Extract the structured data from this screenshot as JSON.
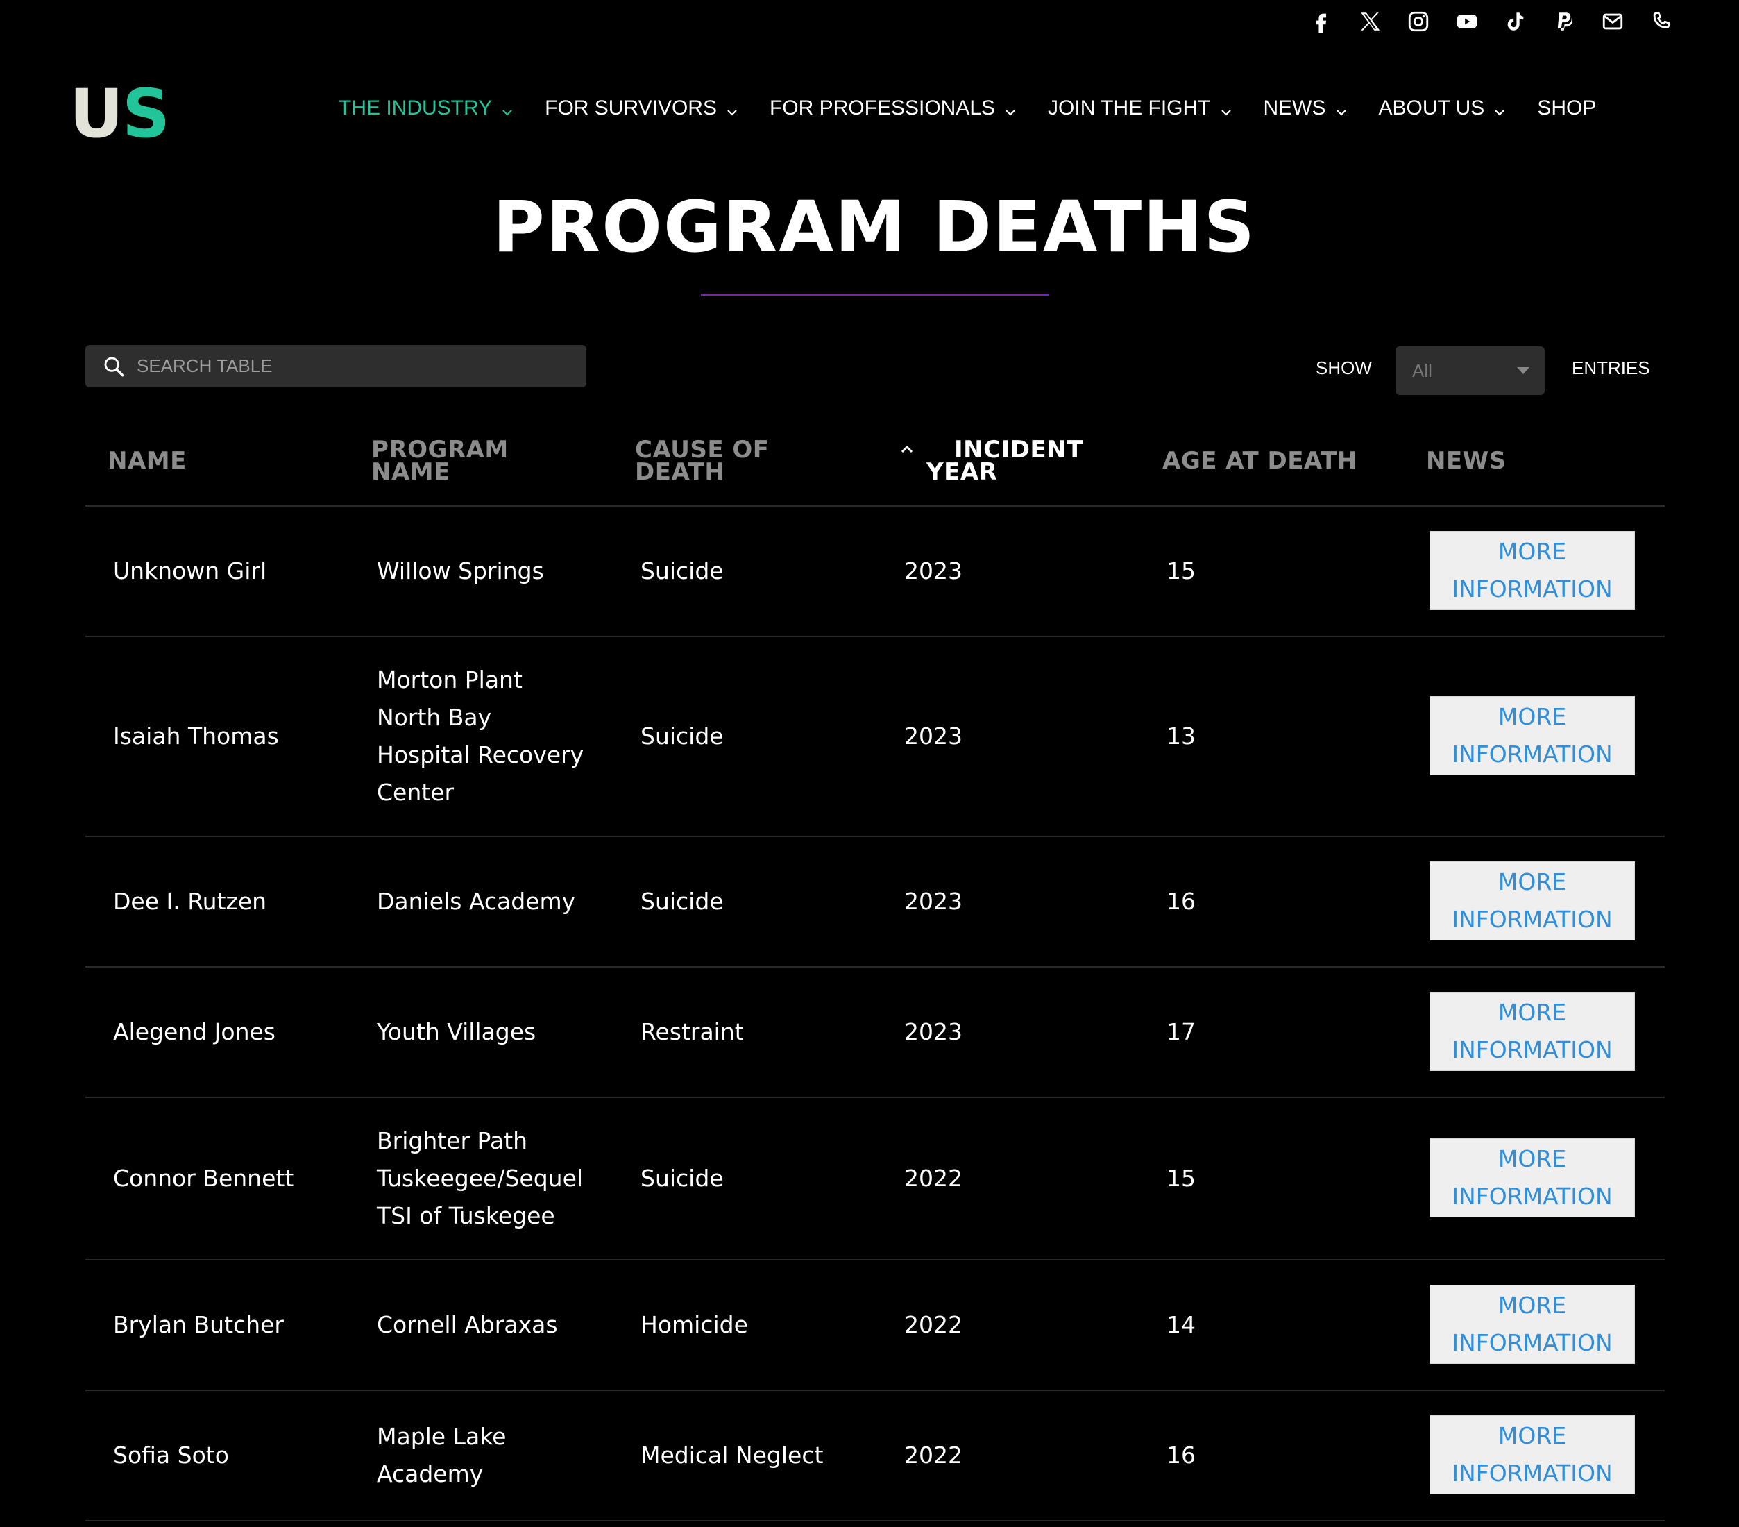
{
  "social": [
    {
      "name": "facebook-icon"
    },
    {
      "name": "x-icon"
    },
    {
      "name": "instagram-icon"
    },
    {
      "name": "youtube-icon"
    },
    {
      "name": "tiktok-icon"
    },
    {
      "name": "paypal-icon"
    },
    {
      "name": "email-icon"
    },
    {
      "name": "phone-icon"
    }
  ],
  "logo": {
    "part1": "U",
    "part2": "S"
  },
  "nav": {
    "items": [
      {
        "label": "THE INDUSTRY",
        "dropdown": true
      },
      {
        "label": "FOR SURVIVORS",
        "dropdown": true
      },
      {
        "label": "FOR PROFESSIONALS",
        "dropdown": true
      },
      {
        "label": "JOIN THE FIGHT",
        "dropdown": true
      },
      {
        "label": "NEWS",
        "dropdown": true
      },
      {
        "label": "ABOUT US",
        "dropdown": true
      },
      {
        "label": "SHOP",
        "dropdown": false
      }
    ],
    "active_color": "#22c49a"
  },
  "page": {
    "title": "PROGRAM DEATHS"
  },
  "search": {
    "placeholder": "SEARCH TABLE",
    "value": ""
  },
  "entries": {
    "show_label": "SHOW",
    "selected": "All",
    "entries_label": "ENTRIES"
  },
  "table": {
    "columns": [
      {
        "line1": "NAME",
        "line2": ""
      },
      {
        "line1": "PROGRAM",
        "line2": "NAME"
      },
      {
        "line1": "CAUSE OF",
        "line2": "DEATH"
      },
      {
        "line1": "INCIDENT",
        "line2": "YEAR"
      },
      {
        "line1": "AGE AT DEATH",
        "line2": ""
      },
      {
        "line1": "NEWS",
        "line2": ""
      }
    ],
    "rows": [
      {
        "name": "Unknown Girl",
        "program": [
          "Willow Springs"
        ],
        "cause": "Suicide",
        "year": "2023",
        "age": "15"
      },
      {
        "name": "Isaiah Thomas",
        "program": [
          "Morton Plant",
          "North Bay",
          "Hospital Recovery",
          "Center"
        ],
        "cause": "Suicide",
        "year": "2023",
        "age": "13"
      },
      {
        "name": "Dee I. Rutzen",
        "program": [
          "Daniels Academy"
        ],
        "cause": "Suicide",
        "year": "2023",
        "age": "16"
      },
      {
        "name": "Alegend Jones",
        "program": [
          "Youth Villages"
        ],
        "cause": "Restraint",
        "year": "2023",
        "age": "17"
      },
      {
        "name": "Connor Bennett",
        "program": [
          "Brighter Path",
          "Tuskeegee/Sequel",
          "TSI of Tuskegee"
        ],
        "cause": "Suicide",
        "year": "2022",
        "age": "15"
      },
      {
        "name": "Brylan Butcher",
        "program": [
          "Cornell Abraxas"
        ],
        "cause": "Homicide",
        "year": "2022",
        "age": "14"
      },
      {
        "name": "Sofia Soto",
        "program": [
          "Maple Lake",
          "Academy"
        ],
        "cause": "Medical Neglect",
        "year": "2022",
        "age": "16"
      }
    ],
    "button_line1": "MORE",
    "button_line2": "INFORMATION"
  }
}
